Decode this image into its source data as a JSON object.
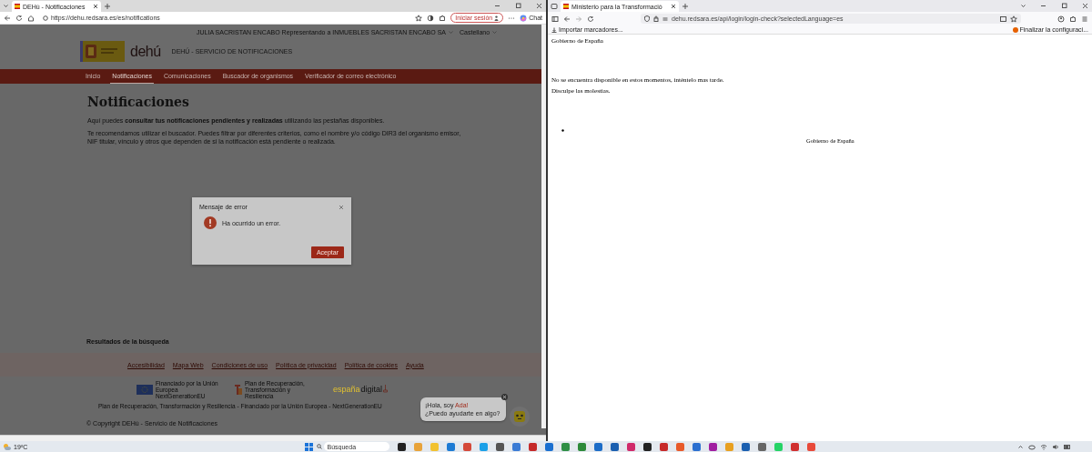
{
  "left_window": {
    "tab": {
      "title": "DEHú - Notificaciones",
      "selected": true
    },
    "url": "https://dehu.redsara.es/es/notifications",
    "signin_button": "Iniciar sesión",
    "copilot_label": "Chat",
    "page": {
      "user": "JULIA SACRISTAN ENCABO Representando a INMUEBLES SACRISTAN ENCABO SA",
      "language": "Castellano",
      "logo_text": "dehú",
      "service_name": "DEHÚ - SERVICIO DE NOTIFICACIONES",
      "nav": [
        {
          "label": "Inicio",
          "selected": false
        },
        {
          "label": "Notificaciones",
          "selected": true
        },
        {
          "label": "Comunicaciones",
          "selected": false
        },
        {
          "label": "Buscador de organismos",
          "selected": false
        },
        {
          "label": "Verificador de correo electrónico",
          "selected": false
        }
      ],
      "title": "Notificaciones",
      "paragraphs": [
        "Aquí puedes **consultar tus notificaciones pendientes y realizadas** utilizando las pestañas disponibles.",
        "Te recomendamos utilizar el buscador. Puedes filtrar por diferentes criterios, como el nombre y/o código DIR3 del organismo emisor, NIF titular, vínculo y otros que dependen de si la notificación está pendiente o realizada."
      ],
      "results_heading": "Resultados de la búsqueda",
      "footer_links": [
        "Accesibilidad",
        "Mapa Web",
        "Condiciones de uso",
        "Política de privacidad",
        "Política de cookies",
        "Ayuda"
      ],
      "eu_logo_text": "Financiado por la Unión Europea NextGenerationEU",
      "plan_logo_text": "Plan de Recuperación, Transformación y Resiliencia",
      "digital_logo": {
        "left": "españa",
        "right": "digital"
      },
      "funding_text": "Plan de Recuperación, Transformación y Resiliencia - Financiado por la Unión Europea - NextGenerationEU",
      "copyright": "© Copyright DEHú - Servicio de Notificaciones",
      "chat": {
        "greeting": "¡Hola, soy",
        "name": "Ada!",
        "question": "¿Puedo ayudarte en algo?"
      }
    },
    "dialog": {
      "title": "Mensaje de error",
      "message": "Ha ocurrido un error.",
      "button": "Aceptar"
    }
  },
  "right_window": {
    "tab": {
      "title": "Ministerio para la Transformació",
      "selected": true
    },
    "url": "dehu.redsara.es/api/login/login-check?selectedLanguage=es",
    "bookmarks": [
      "Importar marcadores...",
      "Finalizar la configuraci..."
    ],
    "page": {
      "header": "Gobierno de España",
      "message": "No se encuentra disponible en estos momentos, inténtelo mas tarde.",
      "apology": "Disculpe las molestias.",
      "footer": "Gobierno de España"
    }
  },
  "taskbar": {
    "temperature": "19ºC",
    "search_placeholder": "Búsqueda"
  }
}
